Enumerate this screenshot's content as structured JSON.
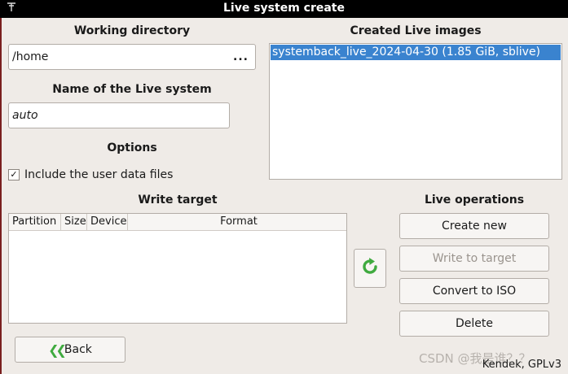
{
  "window": {
    "title": "Live system create",
    "menu_icon": "pin-icon"
  },
  "left": {
    "working_directory_heading": "Working directory",
    "working_directory_value": "/home",
    "browse_label": "...",
    "live_name_heading": "Name of the Live system",
    "live_name_value": "auto",
    "options_heading": "Options",
    "include_user_data_label": "Include the user data files",
    "include_user_data_checked": true,
    "checkmark": "✓"
  },
  "images": {
    "heading": "Created Live images",
    "items": [
      "systemback_live_2024-04-30 (1.85 GiB, sblive)"
    ],
    "selected_index": 0
  },
  "write_target": {
    "heading": "Write target",
    "columns": [
      "Partition",
      "Size",
      "Device",
      "Format"
    ],
    "rows": []
  },
  "operations": {
    "heading": "Live operations",
    "create_new": "Create new",
    "write_to_target": "Write to target",
    "write_to_target_enabled": false,
    "convert_to_iso": "Convert to ISO",
    "delete": "Delete",
    "refresh_icon": "refresh-icon"
  },
  "footer": {
    "back_label": "Back",
    "back_icon": "double-chevron-left-icon",
    "credit": "Kendek, GPLv3",
    "watermark": "CSDN @我是谁？？"
  },
  "colors": {
    "accent": "#3a83cf",
    "icon_green": "#3faa3f",
    "titlebar": "#000000"
  }
}
